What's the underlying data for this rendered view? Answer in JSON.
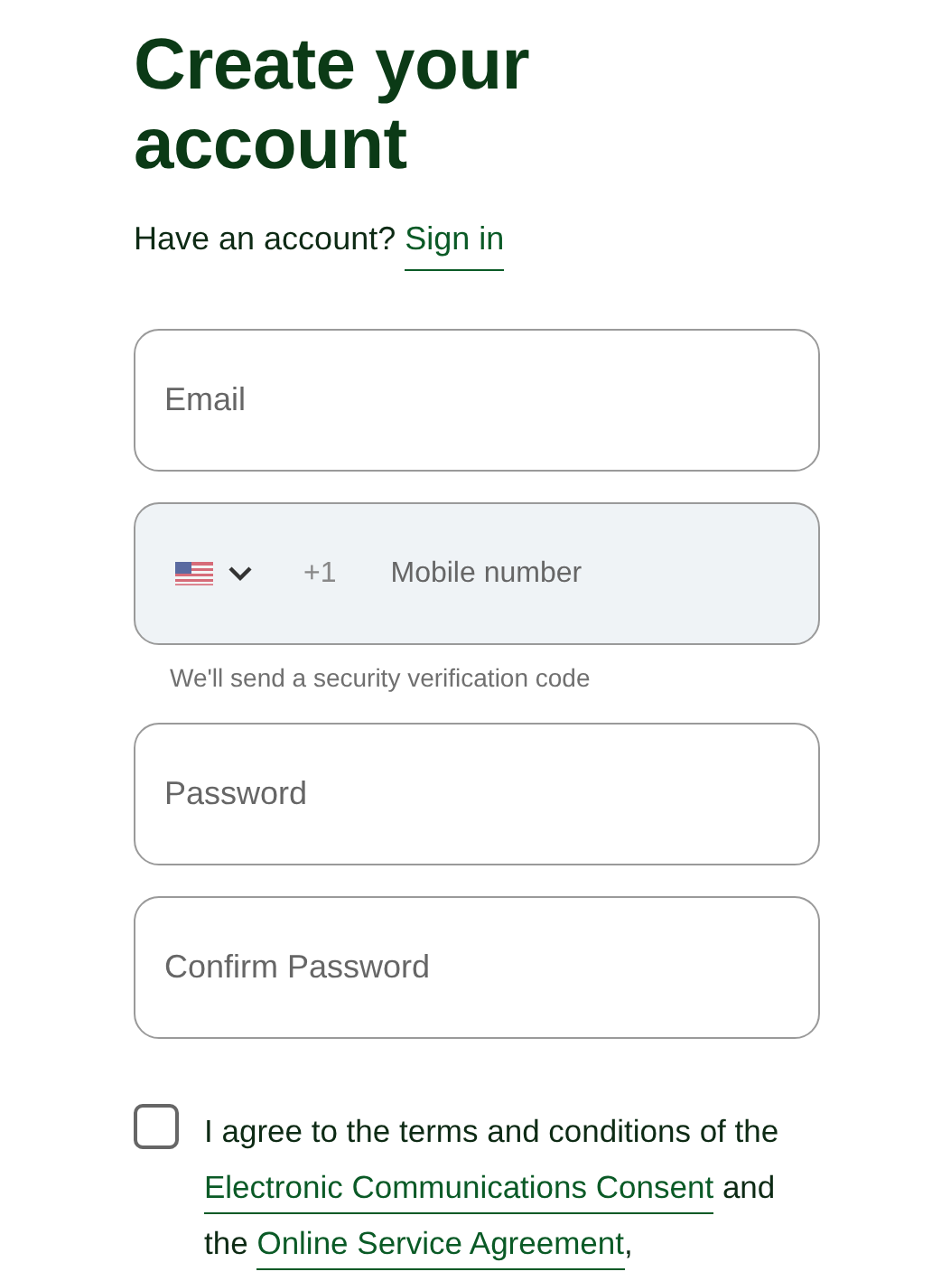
{
  "heading": "Create your account",
  "signin_prompt": {
    "text": "Have an account?",
    "link": "Sign in"
  },
  "email": {
    "placeholder": "Email"
  },
  "phone": {
    "country_code": "+1",
    "placeholder": "Mobile number",
    "hint": "We'll send a security verification code"
  },
  "password": {
    "placeholder": "Password"
  },
  "confirm_password": {
    "placeholder": "Confirm Password"
  },
  "agreement": {
    "checked": false,
    "parts": [
      {
        "kind": "text",
        "text": "I agree to the terms and conditions of the "
      },
      {
        "kind": "link",
        "text": "Electronic Communications Consent"
      },
      {
        "kind": "text",
        "text": " and the "
      },
      {
        "kind": "link",
        "text": "Online Service Agreement"
      },
      {
        "kind": "text",
        "text": ","
      }
    ]
  }
}
